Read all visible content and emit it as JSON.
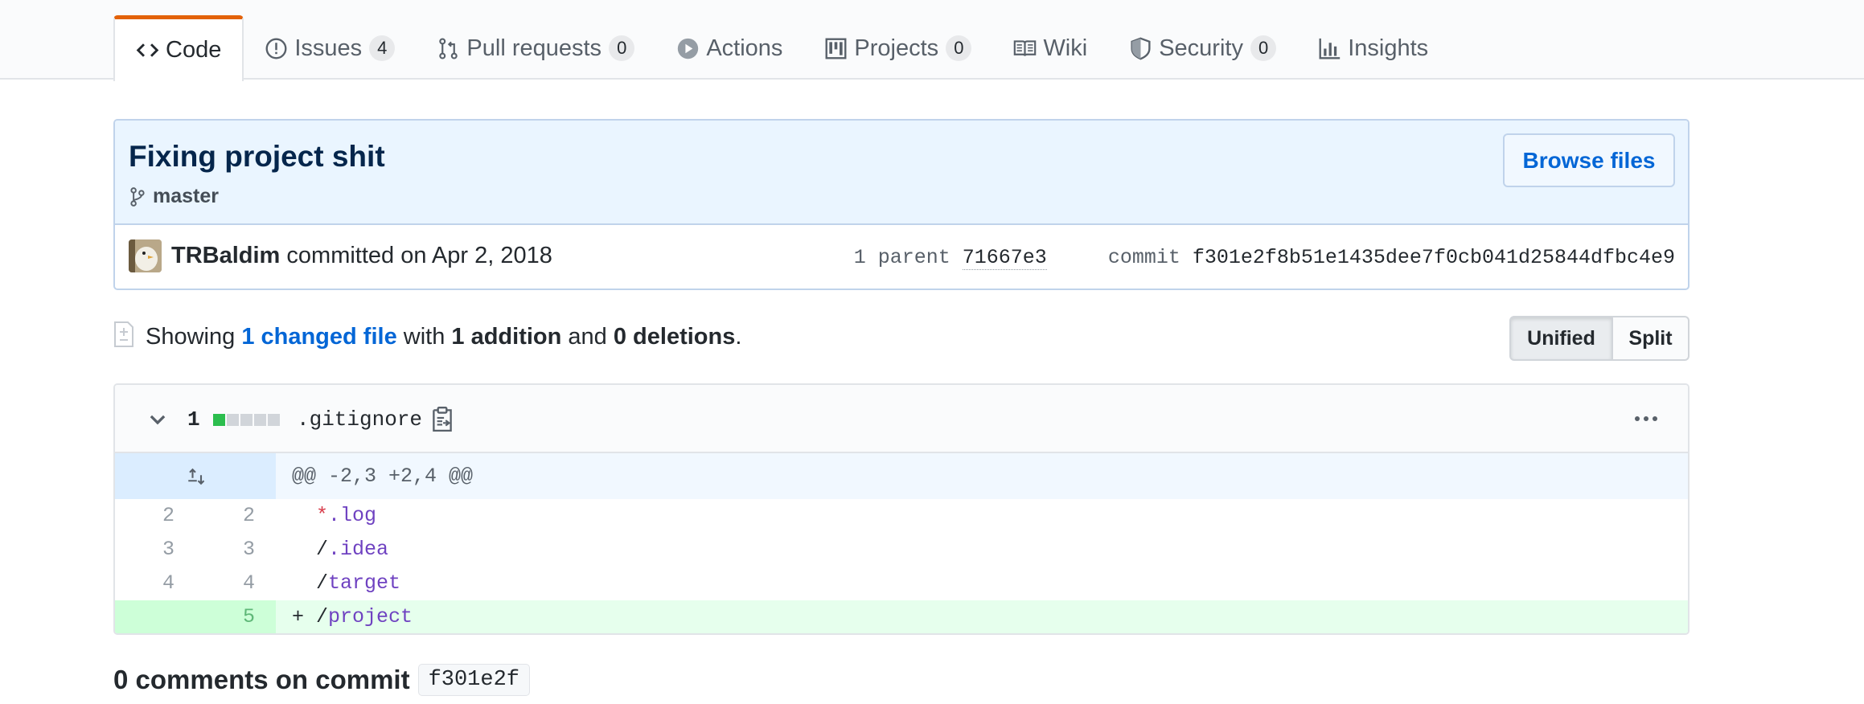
{
  "tabs": [
    {
      "label": "Code",
      "icon": "code-icon",
      "count": null,
      "active": true
    },
    {
      "label": "Issues",
      "icon": "issue-icon",
      "count": "4"
    },
    {
      "label": "Pull requests",
      "icon": "pull-request-icon",
      "count": "0"
    },
    {
      "label": "Actions",
      "icon": "play-icon",
      "count": null
    },
    {
      "label": "Projects",
      "icon": "project-icon",
      "count": "0"
    },
    {
      "label": "Wiki",
      "icon": "book-icon",
      "count": null
    },
    {
      "label": "Security",
      "icon": "shield-icon",
      "count": "0"
    },
    {
      "label": "Insights",
      "icon": "graph-icon",
      "count": null
    }
  ],
  "commit": {
    "title": "Fixing project shit",
    "branch": "master",
    "browse_label": "Browse files",
    "author": "TRBaldim",
    "committed_text": "committed on Apr 2, 2018",
    "parent_label": "1 parent",
    "parent_sha": "71667e3",
    "commit_label": "commit",
    "sha": "f301e2f8b51e1435dee7f0cb041d25844dfbc4e9"
  },
  "summary": {
    "showing": "Showing",
    "changed_files": "1 changed file",
    "with": "with",
    "additions": "1 addition",
    "and": "and",
    "deletions": "0 deletions",
    "period": ".",
    "view_unified": "Unified",
    "view_split": "Split"
  },
  "file": {
    "change_count": "1",
    "name": ".gitignore",
    "hunk_header": "@@ -2,3 +2,4 @@",
    "lines": [
      {
        "old": "2",
        "new": "2",
        "prefix": " ",
        "parts": [
          {
            "t": "*",
            "c": "red"
          },
          {
            "t": ".log",
            "c": "purple"
          }
        ],
        "type": "context"
      },
      {
        "old": "3",
        "new": "3",
        "prefix": " ",
        "parts": [
          {
            "t": "/",
            "c": ""
          },
          {
            "t": ".idea",
            "c": "purple"
          }
        ],
        "type": "context"
      },
      {
        "old": "4",
        "new": "4",
        "prefix": " ",
        "parts": [
          {
            "t": "/",
            "c": ""
          },
          {
            "t": "target",
            "c": "purple"
          }
        ],
        "type": "context"
      },
      {
        "old": "",
        "new": "5",
        "prefix": "+",
        "parts": [
          {
            "t": "/",
            "c": ""
          },
          {
            "t": "project",
            "c": "purple"
          }
        ],
        "type": "add"
      }
    ]
  },
  "comments": {
    "heading": "0 comments on commit",
    "sha_short": "f301e2f"
  },
  "colors": {
    "accent_tab": "#e36209",
    "link": "#0366d6",
    "commit_bg": "#eaf5ff",
    "addition_bg": "#e6ffed",
    "diffstat_add": "#2cbe4e"
  }
}
